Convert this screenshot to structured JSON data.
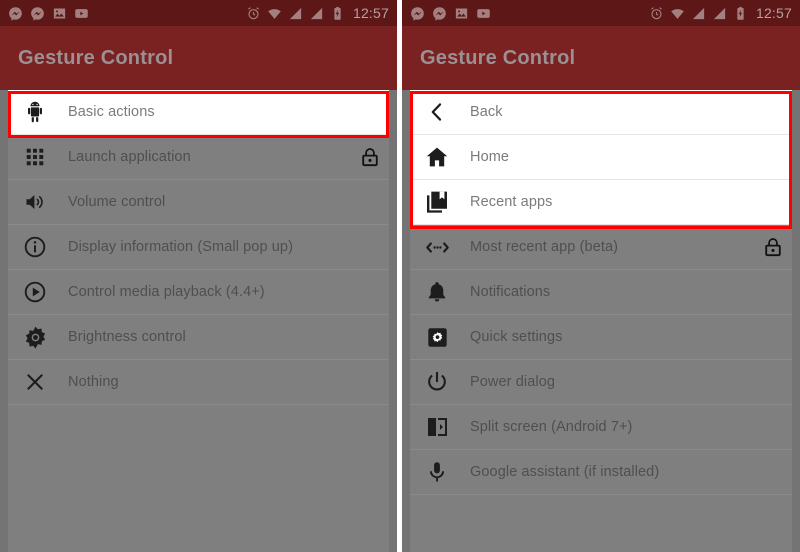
{
  "app": {
    "title": "Gesture Control"
  },
  "status_bar": {
    "time": "12:57",
    "left_icons": [
      "messenger-icon",
      "messenger-icon",
      "photos-icon",
      "youtube-icon"
    ],
    "right_icons": [
      "alarm-icon",
      "wifi-icon",
      "signal-icon",
      "signal-off-icon",
      "battery-icon"
    ]
  },
  "colors": {
    "appbar": "#7a2121",
    "statusbar": "#5e1717",
    "highlight_border": "#fe0000",
    "dim_background": "#7f7f7f",
    "active_row": "#ffffff"
  },
  "left_screen": {
    "title": "Gesture Control",
    "items": [
      {
        "label": "Basic actions",
        "icon": "android-robot-icon",
        "locked": false,
        "highlighted": true
      },
      {
        "label": "Launch application",
        "icon": "apps-grid-icon",
        "locked": true,
        "highlighted": false
      },
      {
        "label": "Volume control",
        "icon": "volume-up-icon",
        "locked": false,
        "highlighted": false
      },
      {
        "label": "Display information (Small pop up)",
        "icon": "info-circle-icon",
        "locked": false,
        "highlighted": false
      },
      {
        "label": "Control media playback (4.4+)",
        "icon": "play-circle-icon",
        "locked": false,
        "highlighted": false
      },
      {
        "label": "Brightness control",
        "icon": "brightness-icon",
        "locked": false,
        "highlighted": false
      },
      {
        "label": "Nothing",
        "icon": "close-x-icon",
        "locked": false,
        "highlighted": false
      }
    ]
  },
  "right_screen": {
    "title": "Gesture Control",
    "items": [
      {
        "label": "Back",
        "icon": "chevron-left-icon",
        "locked": false,
        "highlighted": true
      },
      {
        "label": "Home",
        "icon": "home-icon",
        "locked": false,
        "highlighted": true
      },
      {
        "label": "Recent apps",
        "icon": "recent-apps-icon",
        "locked": false,
        "highlighted": true
      },
      {
        "label": "Most recent app (beta)",
        "icon": "swap-arrows-icon",
        "locked": true,
        "highlighted": false
      },
      {
        "label": "Notifications",
        "icon": "bell-icon",
        "locked": false,
        "highlighted": false
      },
      {
        "label": "Quick settings",
        "icon": "quick-settings-icon",
        "locked": false,
        "highlighted": false
      },
      {
        "label": "Power dialog",
        "icon": "power-icon",
        "locked": false,
        "highlighted": false
      },
      {
        "label": "Split screen (Android 7+)",
        "icon": "split-screen-icon",
        "locked": false,
        "highlighted": false
      },
      {
        "label": "Google assistant (if installed)",
        "icon": "microphone-icon",
        "locked": false,
        "highlighted": false
      }
    ]
  }
}
